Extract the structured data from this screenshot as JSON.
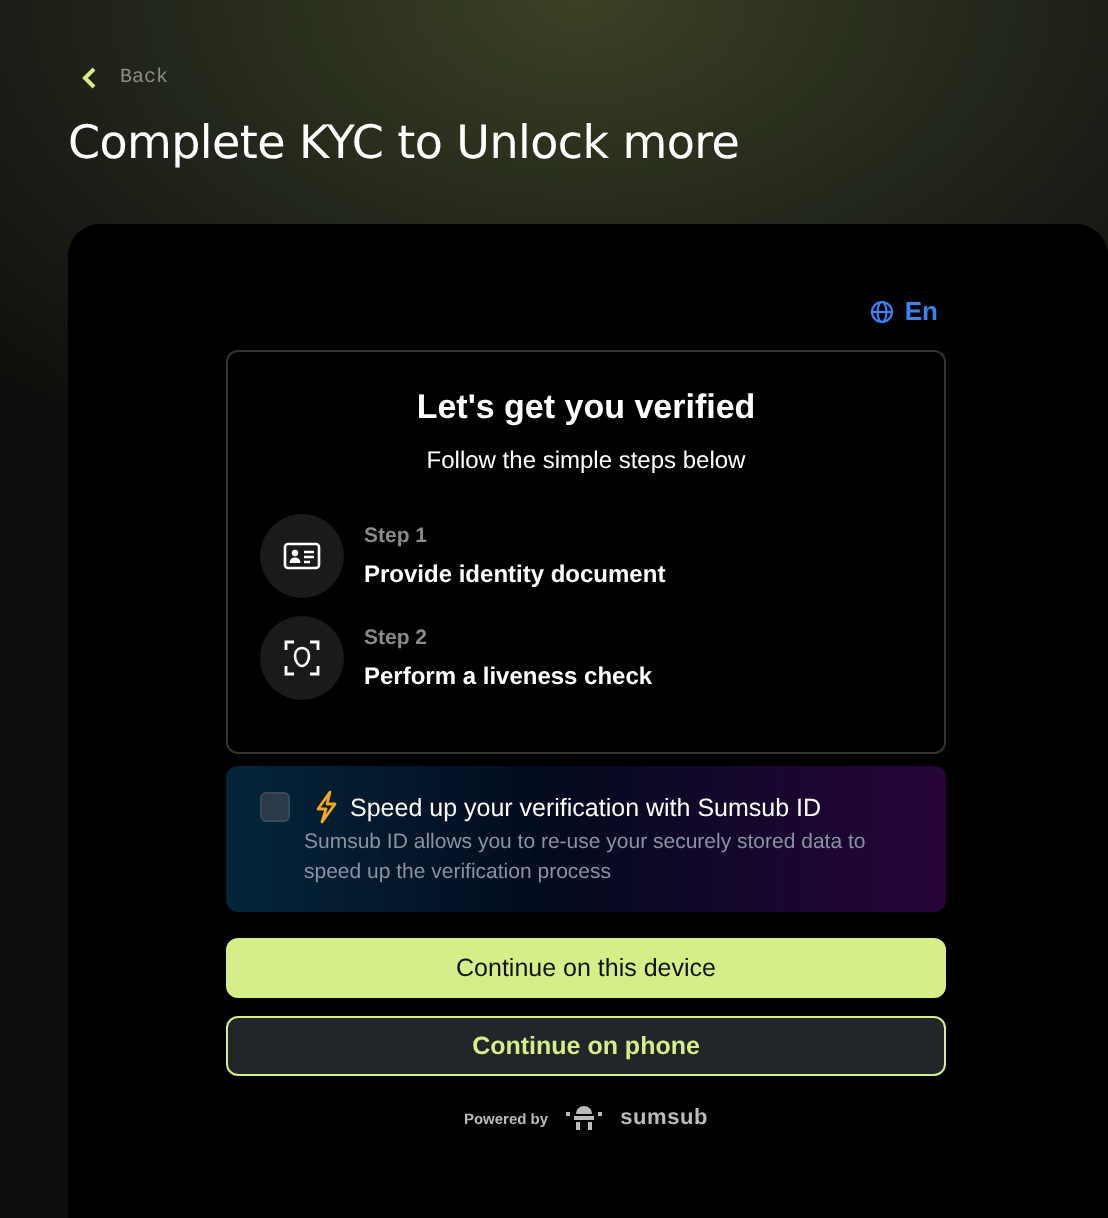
{
  "back": {
    "label": "Back"
  },
  "title": "Complete KYC to Unlock more",
  "language": {
    "label": "En"
  },
  "intro": {
    "heading": "Let's get you verified",
    "subheading": "Follow the simple steps below"
  },
  "steps": [
    {
      "kind": "document",
      "number": "Step 1",
      "label": "Provide identity document"
    },
    {
      "kind": "liveness",
      "number": "Step 2",
      "label": "Perform a liveness check"
    }
  ],
  "sumsub_id": {
    "checked": false,
    "title": "Speed up your verification with Sumsub ID",
    "description": "Sumsub ID allows you to re-use your securely stored data to speed up the verification process"
  },
  "buttons": [
    {
      "kind": "primary",
      "label": "Continue on this device"
    },
    {
      "kind": "secondary",
      "label": "Continue on phone"
    }
  ],
  "footer": {
    "powered_by": "Powered by",
    "brand": "sumsub"
  }
}
